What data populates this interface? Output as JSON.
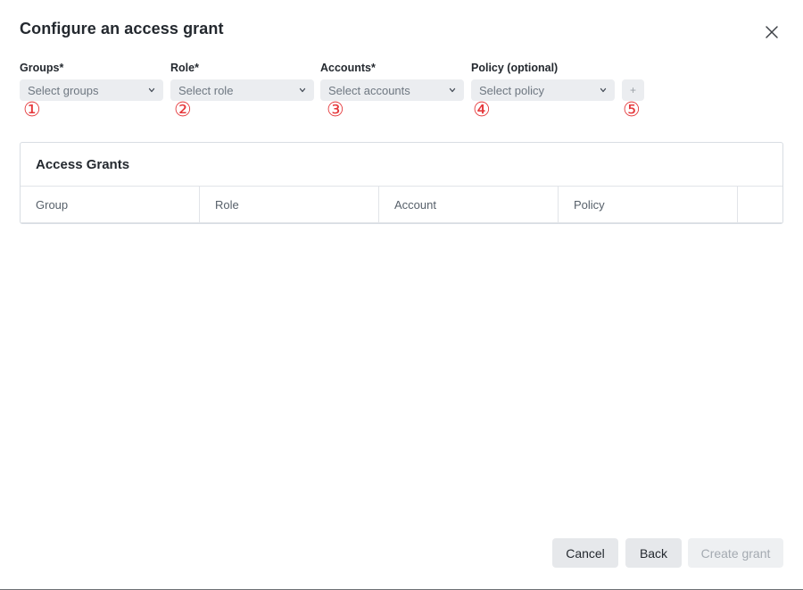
{
  "dialog": {
    "title": "Configure an access grant",
    "close_icon": "close-icon"
  },
  "form": {
    "groups": {
      "label": "Groups*",
      "placeholder": "Select groups",
      "marker": "①"
    },
    "role": {
      "label": "Role*",
      "placeholder": "Select role",
      "marker": "②"
    },
    "accounts": {
      "label": "Accounts*",
      "placeholder": "Select accounts",
      "marker": "③"
    },
    "policy": {
      "label": "Policy (optional)",
      "placeholder": "Select policy",
      "marker": "④"
    },
    "add": {
      "label": "+",
      "marker": "⑤"
    },
    "dropdown_icon": "chevron-down-icon"
  },
  "grants_table": {
    "title": "Access Grants",
    "columns": [
      "Group",
      "Role",
      "Account",
      "Policy",
      ""
    ]
  },
  "footer": {
    "cancel_label": "Cancel",
    "back_label": "Back",
    "create_label": "Create grant"
  },
  "colors": {
    "marker": "#e5383b",
    "field_bg": "#ebedf0",
    "disabled_text": "#a4aab1"
  }
}
